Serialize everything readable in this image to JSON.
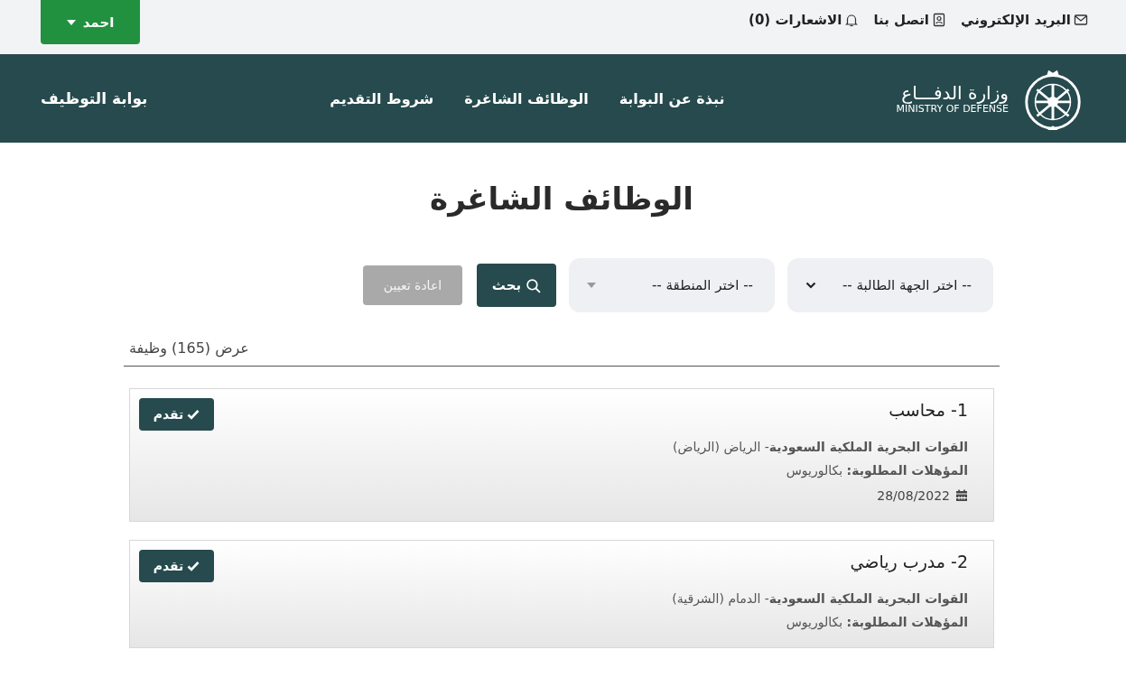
{
  "top_bar": {
    "links": [
      {
        "kind": "email",
        "label": "البريد الإلكتروني"
      },
      {
        "kind": "contact",
        "label": "اتصل بنا"
      },
      {
        "kind": "notifications",
        "label": "الاشعارات (0)"
      }
    ],
    "user_button": "احمد"
  },
  "header": {
    "logo": {
      "arabic": "وزارة الدفـــاع",
      "english": "MINISTRY OF DEFENSE"
    },
    "nav": [
      "نبذة عن البوابة",
      "الوظائف الشاغرة",
      "شروط التقديم"
    ],
    "portal_title": "بوابة التوظيف"
  },
  "page_title": "الوظائف الشاغرة",
  "filters": {
    "selects": [
      {
        "placeholder": "-- اختر الجهة الطالبة --",
        "kind": "chevron"
      },
      {
        "placeholder": "-- اختر المنطقة --",
        "kind": "triangle"
      }
    ],
    "search_button": "بحث",
    "reset_button": {
      "label": "اعادة تعيين",
      "disabled": true
    }
  },
  "results_count": "عرض (165) وظيفة",
  "jobs": [
    {
      "title": "1- محاسب",
      "org": "**القوات البحرية الملكية السعودية**- الرياض (الرياض)",
      "qualification": "**المؤهلات المطلوبة:** بكالوريوس",
      "date": "28/08/2022",
      "apply": "تقدم"
    },
    {
      "title": "2- مدرب رياضي",
      "org": "**القوات البحرية الملكية السعودية**- الدمام (الشرقية)",
      "qualification": "**المؤهلات المطلوبة:** بكالوريوس",
      "apply": "تقدم"
    }
  ]
}
